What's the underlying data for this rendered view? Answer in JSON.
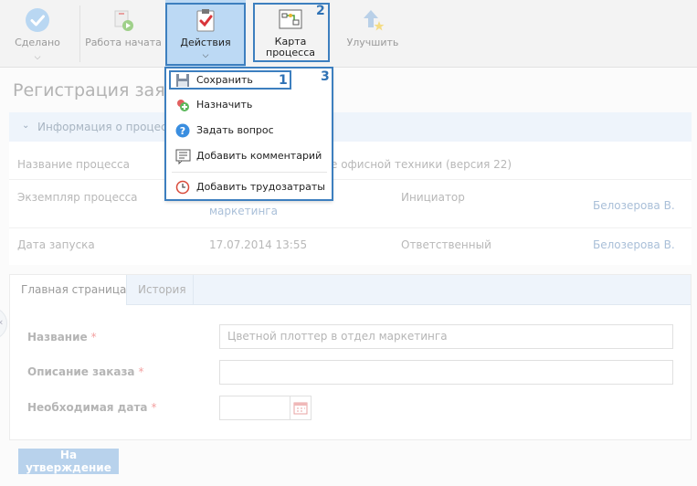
{
  "toolbar": {
    "done_label": "Сделано",
    "work_started_label": "Работа начата",
    "actions_label": "Действия",
    "process_map_label": "Карта процесса",
    "improve_label": "Улучшить"
  },
  "annotations": {
    "n1": "1",
    "n2": "2",
    "n3": "3"
  },
  "actions_menu": {
    "items": [
      {
        "label": "Сохранить",
        "icon": "save-icon"
      },
      {
        "label": "Назначить",
        "icon": "assign-icon"
      },
      {
        "label": "Задать вопрос",
        "icon": "question-icon"
      },
      {
        "label": "Добавить комментарий",
        "icon": "comment-icon"
      },
      {
        "label": "Добавить трудозатраты",
        "icon": "clock-icon"
      }
    ]
  },
  "page": {
    "title": "Регистрация зая"
  },
  "info": {
    "section_title": "Информация о процессе",
    "process_name_label": "Название процесса",
    "process_name_value": "е офисной техники (версия 22)",
    "instance_label": "Экземпляр процесса",
    "instance_value_tail": "маркетинга",
    "initiator_label": "Инициатор",
    "initiator_value": "Белозерова В.",
    "start_date_label": "Дата запуска",
    "start_date_value": "17.07.2014 13:55",
    "responsible_label": "Ответственный",
    "responsible_value": "Белозерова В."
  },
  "tabs": [
    {
      "label": "Главная страница"
    },
    {
      "label": "История"
    }
  ],
  "form": {
    "name_label": "Название",
    "name_value": "Цветной плоттер в отдел маркетинга",
    "description_label": "Описание заказа",
    "description_value": "",
    "date_label": "Необходимая дата",
    "date_value": "",
    "required_mark": "*",
    "submit_label": "На утверждение"
  },
  "colors": {
    "accent": "#3d7fbf",
    "actions_active_bg": "#bcd9f4",
    "done_check": "#b9d7f2"
  }
}
